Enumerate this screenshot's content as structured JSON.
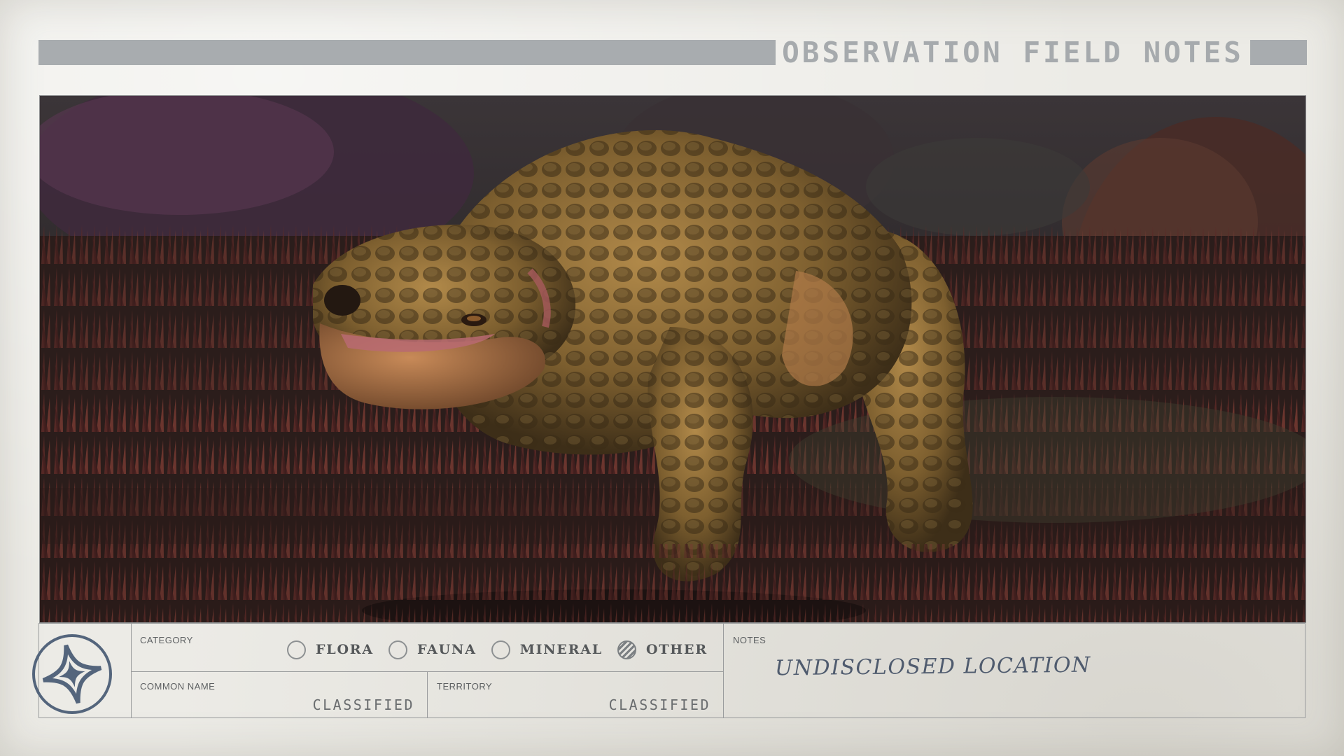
{
  "header": {
    "title": "OBSERVATION FIELD NOTES"
  },
  "photo": {
    "subject": "creature-photo"
  },
  "info": {
    "category_label": "CATEGORY",
    "options": [
      {
        "label": "FLORA",
        "selected": false
      },
      {
        "label": "FAUNA",
        "selected": false
      },
      {
        "label": "MINERAL",
        "selected": false
      },
      {
        "label": "OTHER",
        "selected": true
      }
    ],
    "common_name_label": "COMMON NAME",
    "common_name_value": "CLASSIFIED",
    "territory_label": "TERRITORY",
    "territory_value": "CLASSIFIED",
    "notes_label": "NOTES",
    "notes_text": "UNDISCLOSED LOCATION"
  },
  "colors": {
    "paper": "#ecebe6",
    "header_bar": "#a8acaf",
    "ink": "#55585a",
    "handwriting": "#4f5b6e"
  }
}
